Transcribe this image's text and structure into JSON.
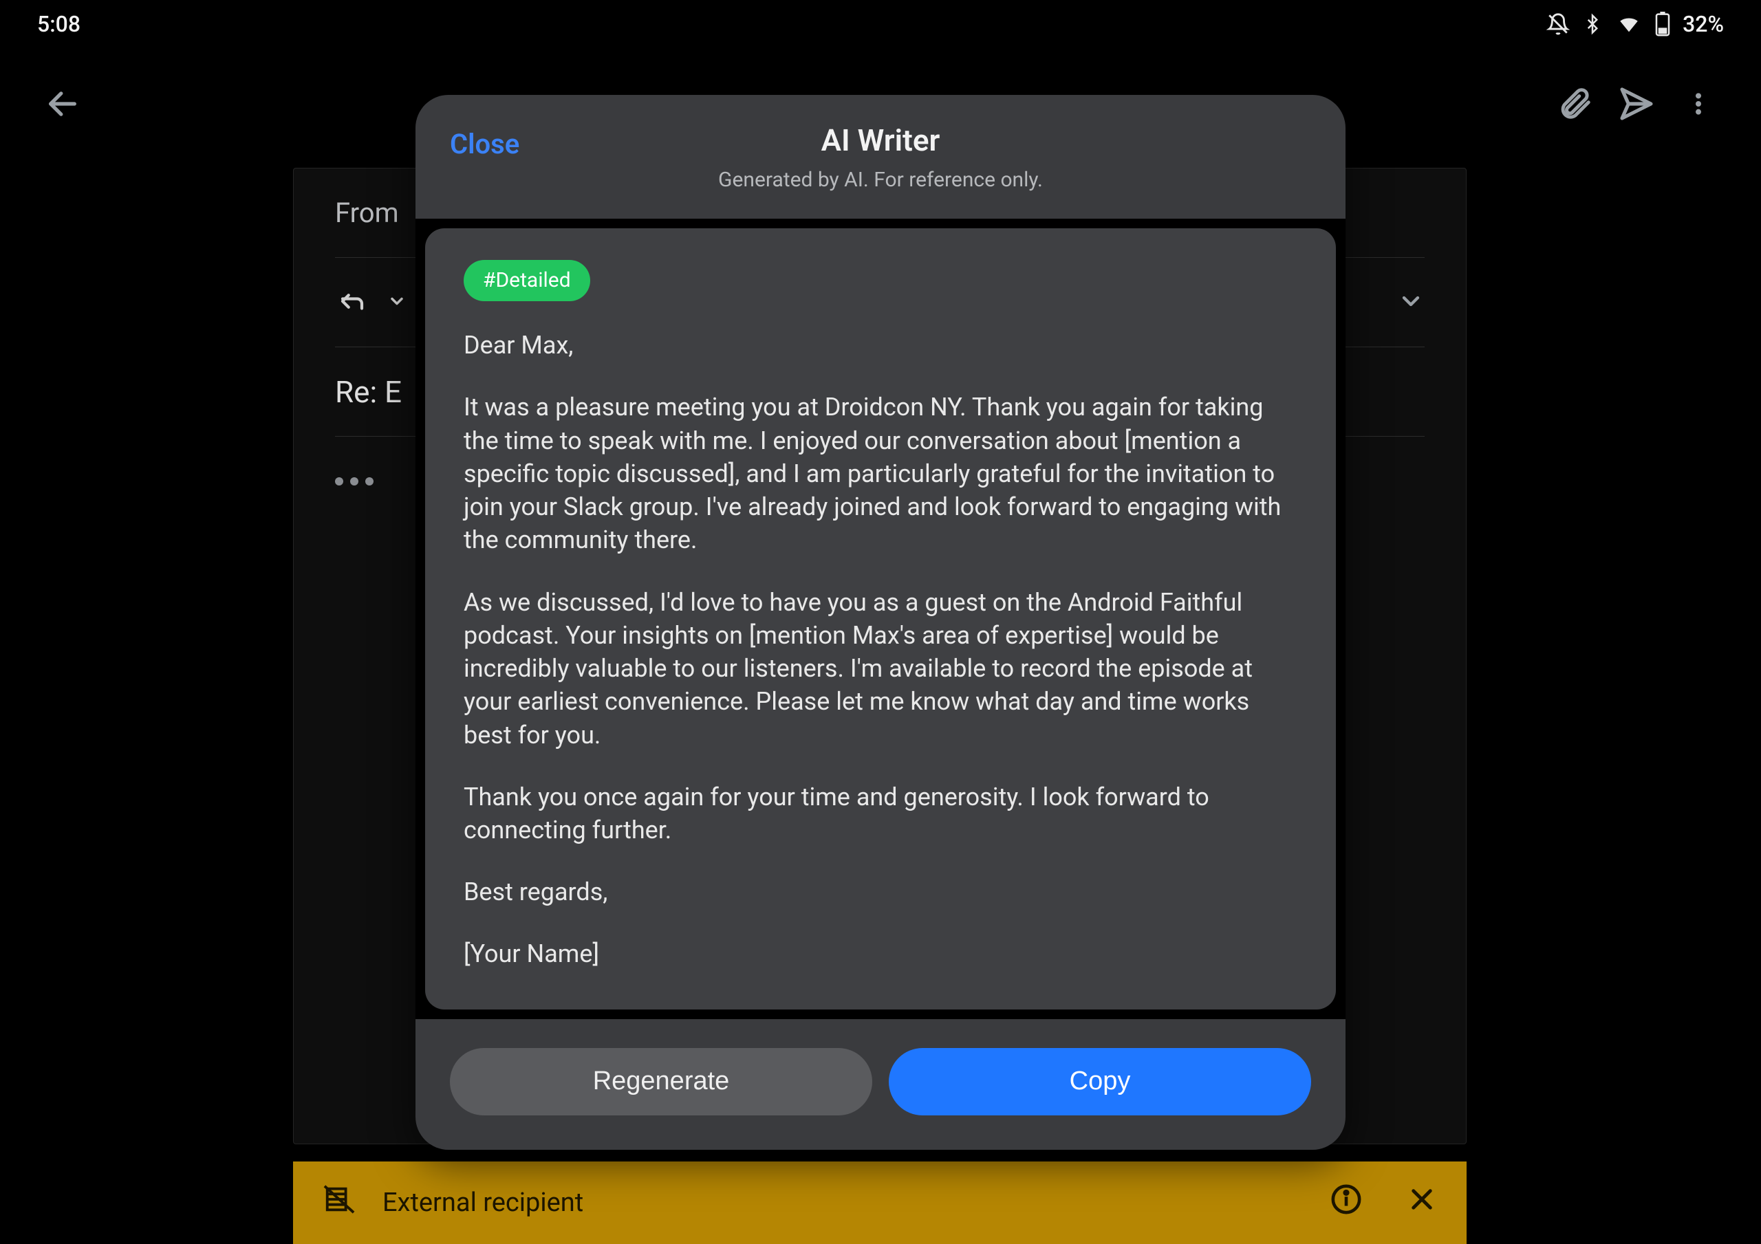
{
  "status": {
    "time": "5:08",
    "battery_pct": "32%"
  },
  "compose": {
    "from_label": "From",
    "subject_prefix": "Re: E"
  },
  "banner": {
    "text": "External recipient"
  },
  "modal": {
    "close_label": "Close",
    "title": "AI Writer",
    "subtitle": "Generated by AI. For reference only.",
    "tag": "#Detailed",
    "paragraphs": [
      "Dear Max,",
      "It was a pleasure meeting you at Droidcon NY. Thank you again for taking the time to speak with me. I enjoyed our conversation about [mention a specific topic discussed], and I am particularly grateful for the invitation to join your Slack group. I've already joined and look forward to engaging with the community there.",
      "As we discussed, I'd love to have you as a guest on the Android Faithful podcast. Your insights on [mention Max's area of expertise] would be incredibly valuable to our listeners. I'm available to record the episode at your earliest convenience. Please let me know what day and time works best for you.",
      "Thank you once again for your time and generosity. I look forward to connecting further.",
      "Best regards,",
      "[Your Name]"
    ],
    "regenerate_label": "Regenerate",
    "copy_label": "Copy"
  }
}
